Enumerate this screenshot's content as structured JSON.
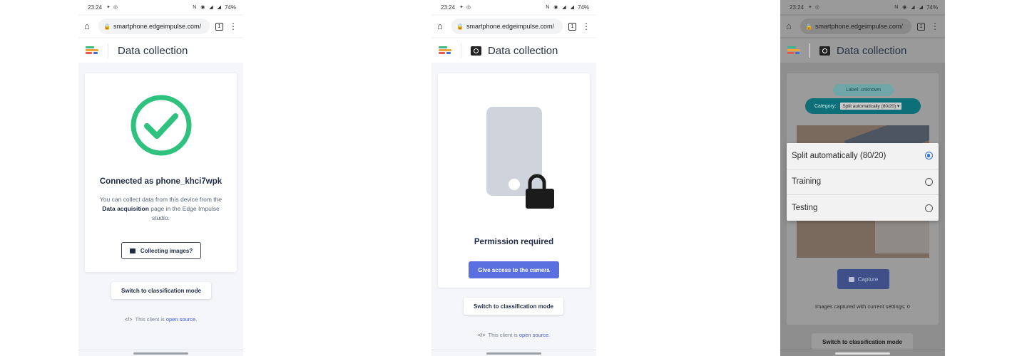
{
  "status_bar": {
    "time": "23:24",
    "battery": "74%"
  },
  "browser": {
    "url": "smartphone.edgeimpulse.com/",
    "tab_count": "1"
  },
  "app": {
    "title": "Data collection"
  },
  "screen1": {
    "heading": "Connected as phone_khci7wpk",
    "desc_pre": "You can collect data from this device from the ",
    "desc_link": "Data acquisition",
    "desc_post": " page in the Edge Impulse studio.",
    "collect_button": "Collecting images?",
    "switch_button": "Switch to classification mode",
    "footer_pre": "This client is ",
    "footer_link": "open source",
    "footer_post": "."
  },
  "screen2": {
    "heading": "Permission required",
    "access_button": "Give access to the camera",
    "switch_button": "Switch to classification mode",
    "footer_pre": "This client is ",
    "footer_link": "open source",
    "footer_post": "."
  },
  "screen3": {
    "label": "Label: unknown",
    "category_label": "Category:",
    "category_value": "Split automatically (80/20) ▾",
    "capture_button": "Capture",
    "captured_text": "Images captured with current settings: 0",
    "switch_button": "Switch to classification mode",
    "options": [
      {
        "label": "Split automatically (80/20)",
        "selected": true
      },
      {
        "label": "Training",
        "selected": false
      },
      {
        "label": "Testing",
        "selected": false
      }
    ]
  },
  "colors": {
    "success_green": "#2ec27e",
    "primary_blue": "#5a6fe0",
    "link_blue": "#3f5ad8",
    "category_teal": "#0f6f78"
  },
  "icons": [
    "home-icon",
    "lock-icon",
    "tabs-icon",
    "menu-icon",
    "logo",
    "camera-icon",
    "check-circle-icon",
    "phone-lock-icon",
    "code-icon",
    "radio-icon"
  ]
}
